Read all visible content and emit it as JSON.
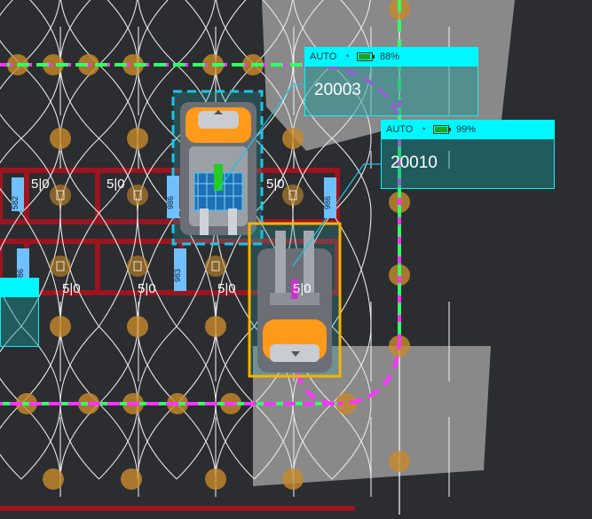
{
  "robots": [
    {
      "mode": "AUTO",
      "id": "20003",
      "battery_percent": 88,
      "battery_label": "88%",
      "wifi_icon": "wifi-icon",
      "battery_icon": "battery-icon"
    },
    {
      "mode": "AUTO",
      "id": "20010",
      "battery_percent": 99,
      "battery_label": "99%",
      "wifi_icon": "wifi-icon",
      "battery_icon": "battery-icon"
    }
  ],
  "bin_labels": [
    "5|0",
    "5|0",
    "5|0",
    "5|0",
    "5|0",
    "5|0",
    "5|0"
  ],
  "aisle_tags": [
    "582",
    "986",
    "983",
    "986",
    "986"
  ],
  "colors": {
    "background": "#2b2d31",
    "shelf_red": "#9b1420",
    "node_orange": "#c88a2a",
    "path_magenta": "#ff33ff",
    "path_green": "#33ff66",
    "card_cyan": "#00f7ff",
    "forklift_orange": "#ff9a1a",
    "selection_cyan": "#19c6e6",
    "selection_gold": "#f5b400",
    "zone_gray": "#9a9a9a",
    "tag_blue": "#6fc0ff"
  }
}
